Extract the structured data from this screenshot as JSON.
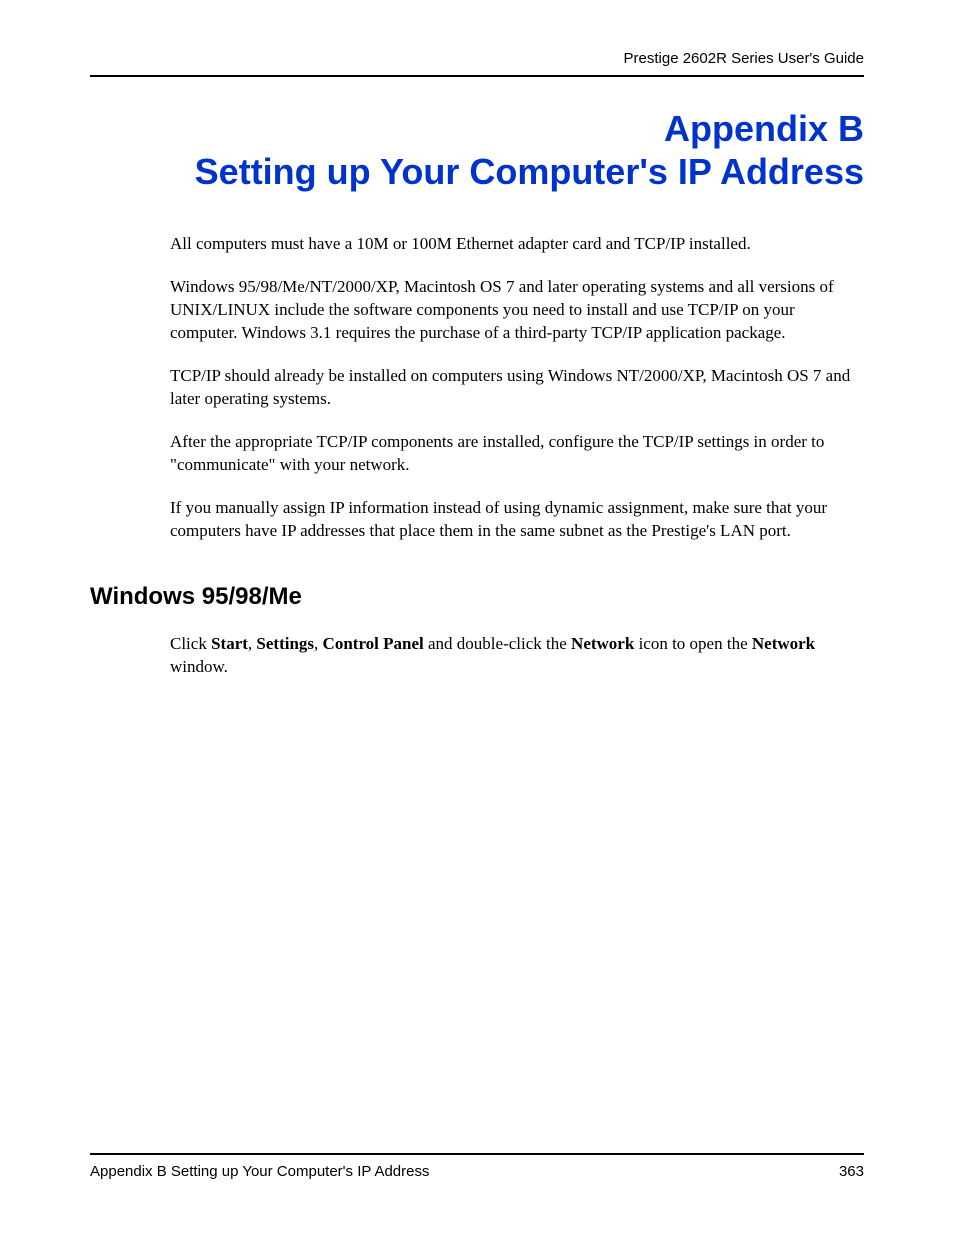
{
  "header": {
    "guide_title": "Prestige 2602R Series User's Guide"
  },
  "title": {
    "appendix_label": "Appendix B",
    "appendix_title": "Setting up Your Computer's IP Address"
  },
  "paragraphs": {
    "p1": "All computers must have a 10M or 100M Ethernet adapter card and TCP/IP installed.",
    "p2": "Windows 95/98/Me/NT/2000/XP, Macintosh OS 7 and later operating systems and all versions of UNIX/LINUX include the software components you need to install and use TCP/IP on your computer. Windows 3.1 requires the purchase of a third-party TCP/IP application package.",
    "p3": "TCP/IP should already be installed on computers using Windows NT/2000/XP, Macintosh OS 7 and later operating systems.",
    "p4": "After the appropriate TCP/IP components are installed, configure the TCP/IP settings in order to \"communicate\" with your network.",
    "p5": "If you manually assign IP information instead of using dynamic assignment, make sure that your computers have IP addresses that place them in the same subnet as the Prestige's LAN port."
  },
  "section": {
    "heading": "Windows 95/98/Me",
    "instruction_parts": {
      "t0": "Click ",
      "b1": "Start",
      "t1": ", ",
      "b2": "Settings",
      "t2": ", ",
      "b3": "Control Panel",
      "t3": " and double-click the ",
      "b4": "Network",
      "t4": " icon to open the ",
      "b5": "Network",
      "t5": " window."
    }
  },
  "footer": {
    "left": "Appendix B Setting up Your Computer's IP Address",
    "right": "363"
  }
}
